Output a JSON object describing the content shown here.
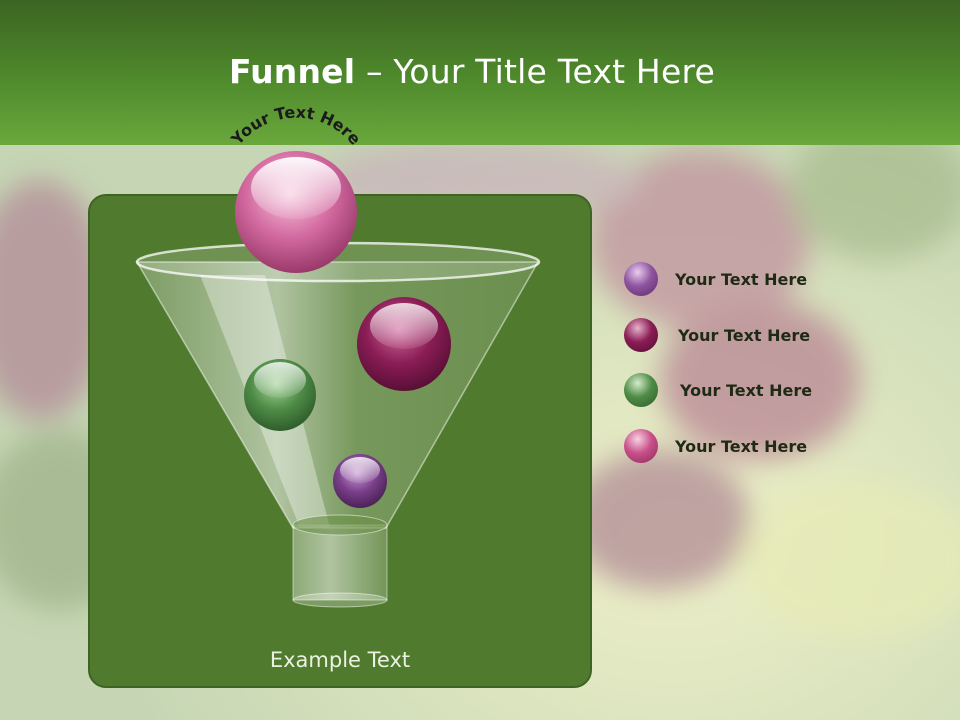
{
  "slide": {
    "title_bold": "Funnel",
    "title_rest": " – Your Title Text Here",
    "arc_label": "Your Text Here",
    "example_text": "Example Text"
  },
  "legend": [
    {
      "label": "Your  Text Here",
      "color": "#7a3f8a"
    },
    {
      "label": "Your  Text Here",
      "color": "#8a1d55"
    },
    {
      "label": "Your  Text Here",
      "color": "#4d8a43"
    },
    {
      "label": "Your  Text Here",
      "color": "#c0457e"
    }
  ],
  "colors": {
    "header": "#4f8a2c",
    "panel": "#507b2e",
    "ball_pink": "#d36aa0",
    "ball_magenta": "#8a1d55",
    "ball_green": "#4f8c47",
    "ball_purple": "#7a3f8a"
  }
}
